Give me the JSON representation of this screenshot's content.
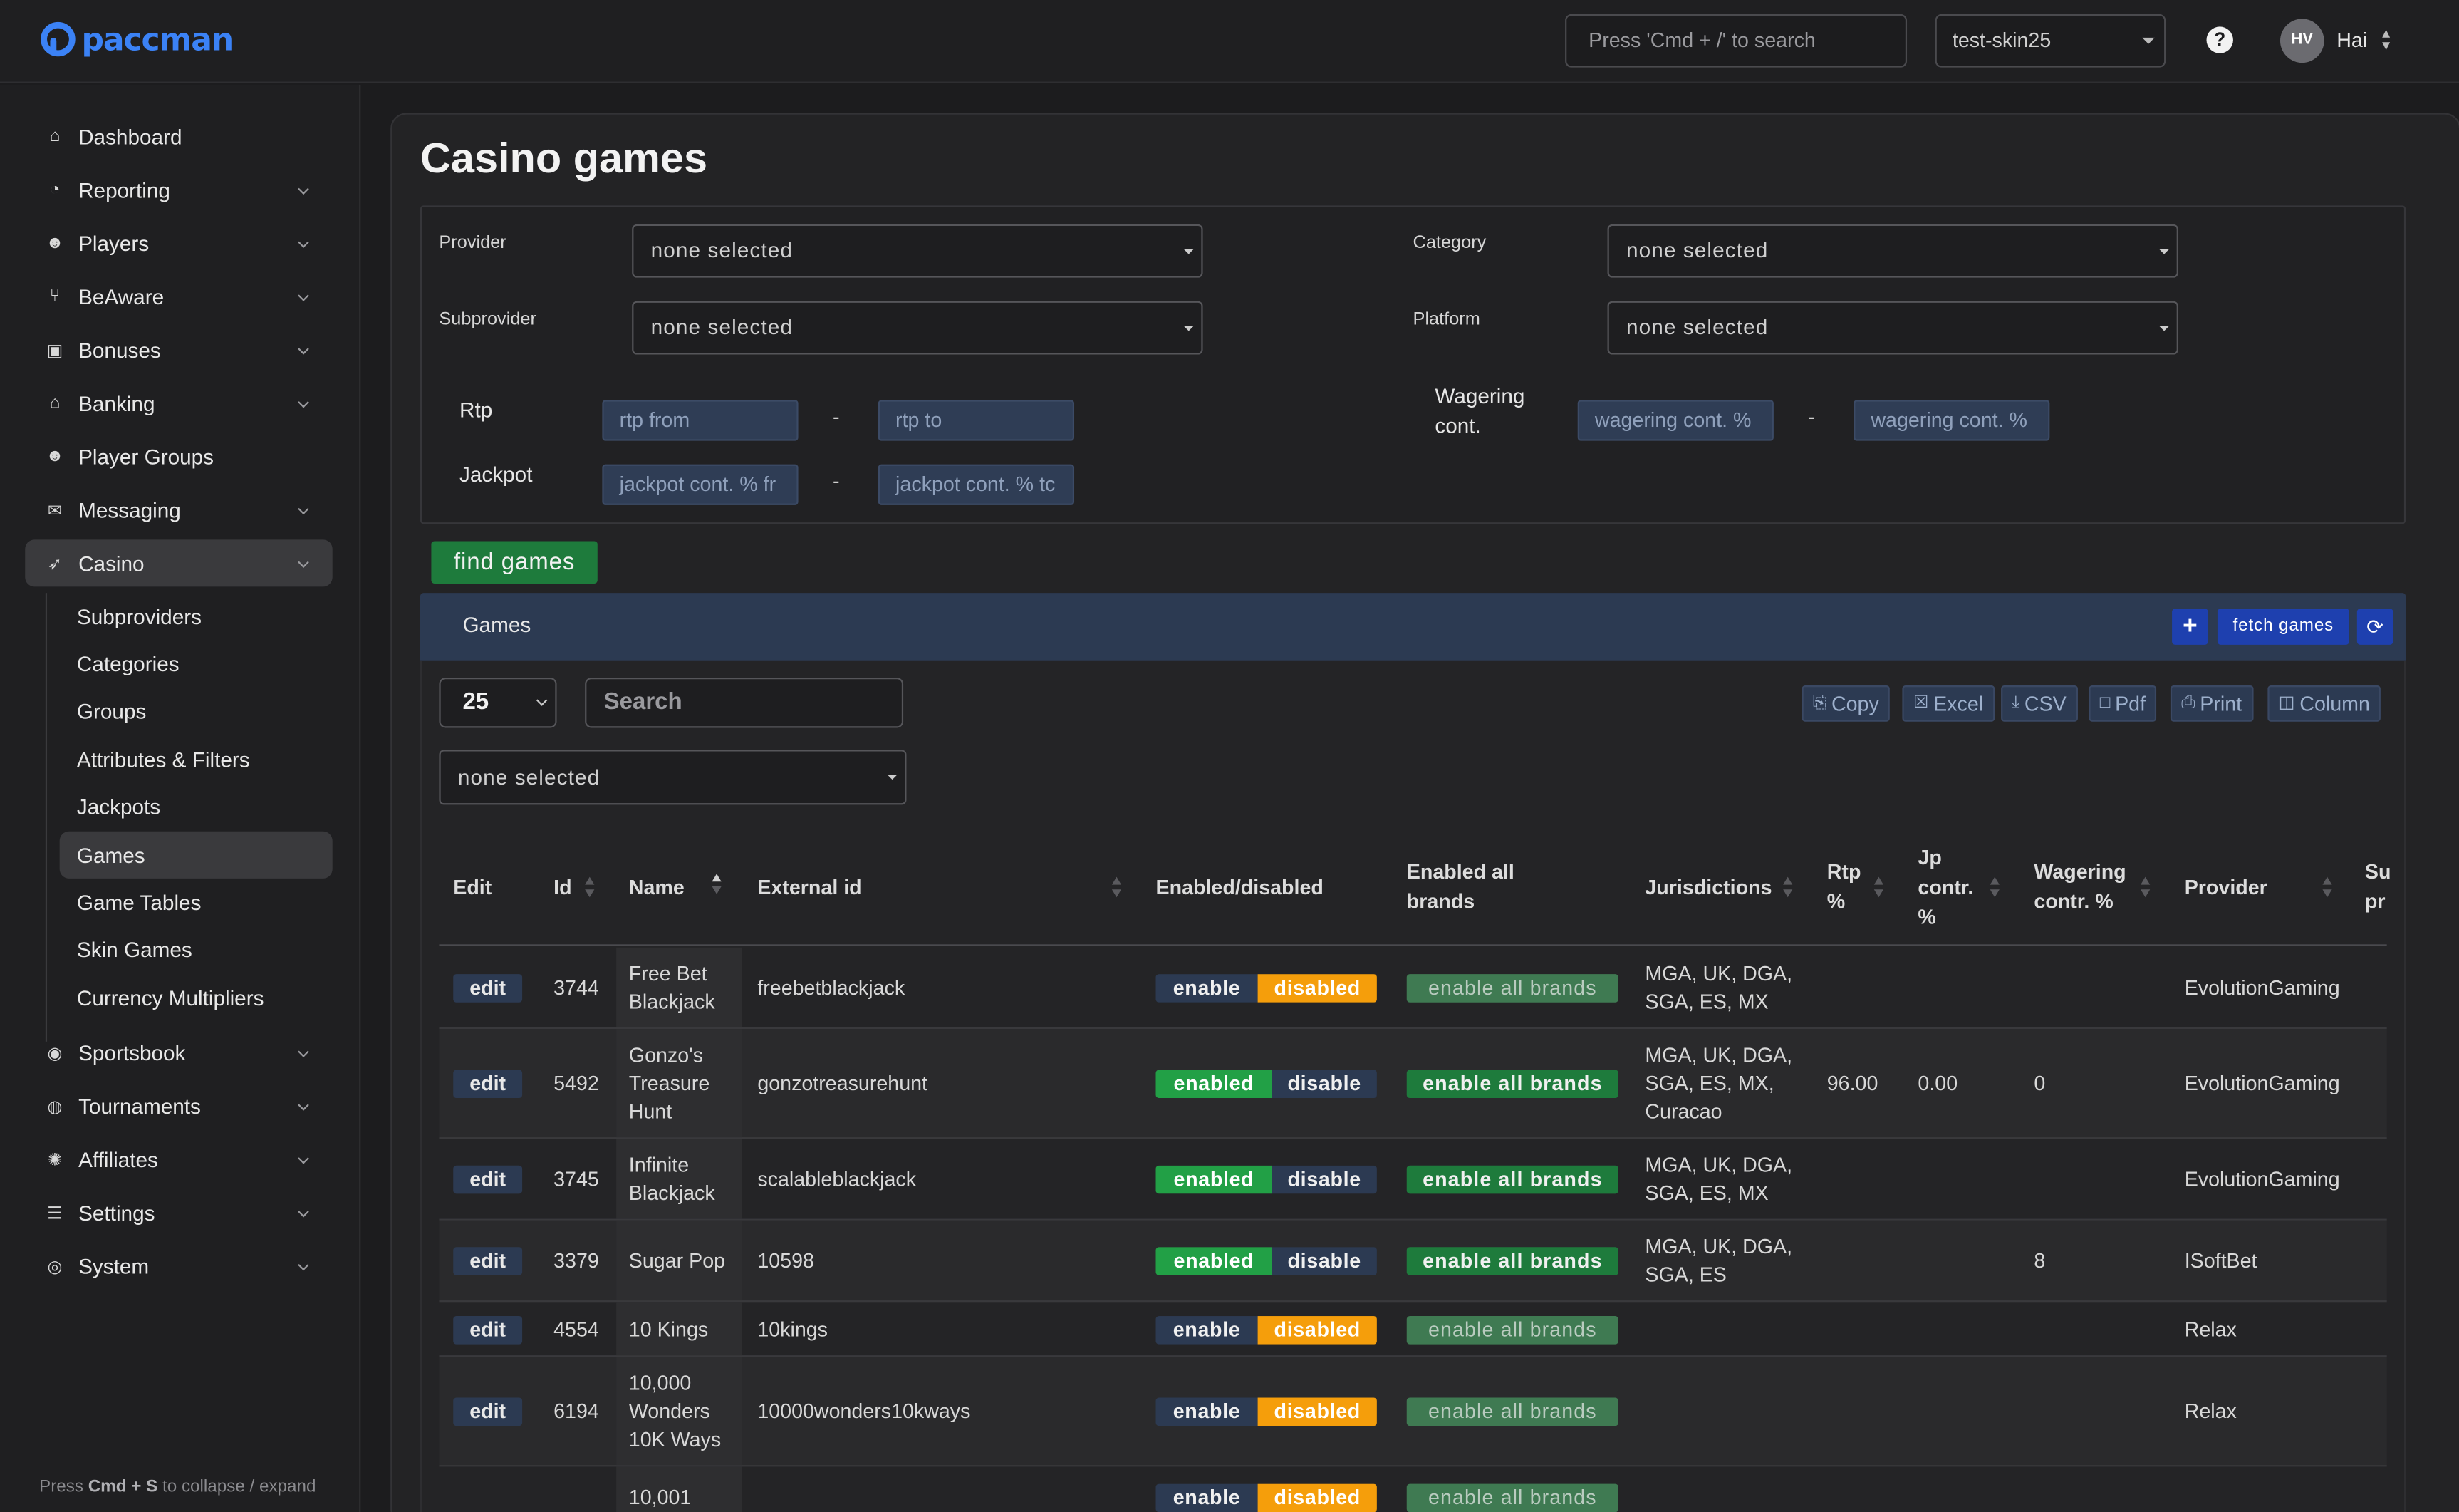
{
  "topbar": {
    "logo_text": "paccman",
    "search_placeholder": "Press 'Cmd + /' to search",
    "skin": "test-skin25",
    "help": "?",
    "avatar_initials": "HV",
    "user_name": "Hai"
  },
  "sidebar": {
    "items": [
      {
        "label": "Dashboard",
        "icon": "home-icon",
        "expandable": false
      },
      {
        "label": "Reporting",
        "icon": "pie-chart-icon",
        "expandable": true
      },
      {
        "label": "Players",
        "icon": "users-icon",
        "expandable": true
      },
      {
        "label": "BeAware",
        "icon": "branch-icon",
        "expandable": true
      },
      {
        "label": "Bonuses",
        "icon": "money-icon",
        "expandable": true
      },
      {
        "label": "Banking",
        "icon": "bank-icon",
        "expandable": true
      },
      {
        "label": "Player Groups",
        "icon": "group-icon",
        "expandable": false
      },
      {
        "label": "Messaging",
        "icon": "envelope-icon",
        "expandable": true
      },
      {
        "label": "Casino",
        "icon": "rocket-icon",
        "expandable": true
      },
      {
        "label": "Sportsbook",
        "icon": "ball-icon",
        "expandable": true
      },
      {
        "label": "Tournaments",
        "icon": "globe-icon",
        "expandable": true
      },
      {
        "label": "Affiliates",
        "icon": "sparkle-icon",
        "expandable": true
      },
      {
        "label": "Settings",
        "icon": "sliders-icon",
        "expandable": true
      },
      {
        "label": "System",
        "icon": "target-icon",
        "expandable": true
      }
    ],
    "casino_sub": [
      "Subproviders",
      "Categories",
      "Groups",
      "Attributes & Filters",
      "Jackpots",
      "Games",
      "Game Tables",
      "Skin Games",
      "Currency Multipliers"
    ],
    "footer_pre": "Press ",
    "footer_key": "Cmd + S",
    "footer_post": " to collapse / expand"
  },
  "page": {
    "title": "Casino games"
  },
  "filters": {
    "provider_label": "Provider",
    "provider_value": "none selected",
    "subprovider_label": "Subprovider",
    "subprovider_value": "none selected",
    "category_label": "Category",
    "category_value": "none selected",
    "platform_label": "Platform",
    "platform_value": "none selected",
    "rtp_label": "Rtp",
    "rtp_from": "rtp from",
    "rtp_to": "rtp to",
    "jackpot_label": "Jackpot",
    "jackpot_from": "jackpot cont. % fr",
    "jackpot_to": "jackpot cont. % tc",
    "wagering_label_1": "Wagering",
    "wagering_label_2": "cont.",
    "wagering_from": "wagering cont. %",
    "wagering_to": "wagering cont. %",
    "dash": "-",
    "find_button": "find games"
  },
  "games_panel": {
    "title": "Games",
    "add": "+",
    "fetch": "fetch games",
    "refresh": "⟳",
    "page_length": "25",
    "search_placeholder": "Search",
    "column_filter": "none selected",
    "export": {
      "copy": "Copy",
      "excel": "Excel",
      "csv": "CSV",
      "pdf": "Pdf",
      "print": "Print",
      "column": "Column"
    }
  },
  "table": {
    "headers": {
      "edit": "Edit",
      "id": "Id",
      "name": "Name",
      "external_id": "External id",
      "enabled": "Enabled/disabled",
      "all_brands_1": "Enabled all",
      "all_brands_2": "brands",
      "jurisdictions": "Jurisdictions",
      "rtp_1": "Rtp",
      "rtp_2": "%",
      "jp_1": "Jp",
      "jp_2": "contr.",
      "jp_3": "%",
      "wager_1": "Wagering",
      "wager_2": "contr. %",
      "provider": "Provider",
      "sub_1": "Su",
      "sub_2": "pr"
    },
    "labels": {
      "edit": "edit",
      "enable": "enable",
      "enabled": "enabled",
      "disable": "disable",
      "disabled": "disabled",
      "all_brands": "enable all brands"
    },
    "rows": [
      {
        "id": "3744",
        "name": [
          "Free Bet",
          "Blackjack"
        ],
        "external": "freebetblackjack",
        "enabled": false,
        "jur": [
          "MGA, UK, DGA,",
          "SGA, ES, MX"
        ],
        "rtp": "",
        "jp": "",
        "wager": "",
        "provider": "EvolutionGaming"
      },
      {
        "id": "5492",
        "name": [
          "Gonzo's",
          "Treasure",
          "Hunt"
        ],
        "external": "gonzotreasurehunt",
        "enabled": true,
        "jur": [
          "MGA, UK, DGA,",
          "SGA, ES, MX,",
          "Curacao"
        ],
        "rtp": "96.00",
        "jp": "0.00",
        "wager": "0",
        "provider": "EvolutionGaming"
      },
      {
        "id": "3745",
        "name": [
          "Infinite",
          "Blackjack"
        ],
        "external": "scalableblackjack",
        "enabled": true,
        "jur": [
          "MGA, UK, DGA,",
          "SGA, ES, MX"
        ],
        "rtp": "",
        "jp": "",
        "wager": "",
        "provider": "EvolutionGaming"
      },
      {
        "id": "3379",
        "name": [
          "Sugar Pop"
        ],
        "external": "10598",
        "enabled": true,
        "jur": [
          "MGA, UK, DGA,",
          "SGA, ES"
        ],
        "rtp": "",
        "jp": "",
        "wager": "8",
        "provider": "ISoftBet"
      },
      {
        "id": "4554",
        "name": [
          "10 Kings"
        ],
        "external": "10kings",
        "enabled": false,
        "jur": [],
        "rtp": "",
        "jp": "",
        "wager": "",
        "provider": "Relax"
      },
      {
        "id": "6194",
        "name": [
          "10,000",
          "Wonders",
          "10K Ways"
        ],
        "external": "10000wonders10kways",
        "enabled": false,
        "jur": [],
        "rtp": "",
        "jp": "",
        "wager": "",
        "provider": "Relax"
      },
      {
        "id": "",
        "name": [
          "10,001"
        ],
        "external": "",
        "enabled": false,
        "jur": [],
        "rtp": "",
        "jp": "",
        "wager": "",
        "provider": ""
      }
    ]
  },
  "colors": {
    "accent": "#3b82f6",
    "navy": "#2c3a52",
    "green": "#22a046",
    "dark_green": "#1e7b3c",
    "orange": "#f59e0b"
  }
}
